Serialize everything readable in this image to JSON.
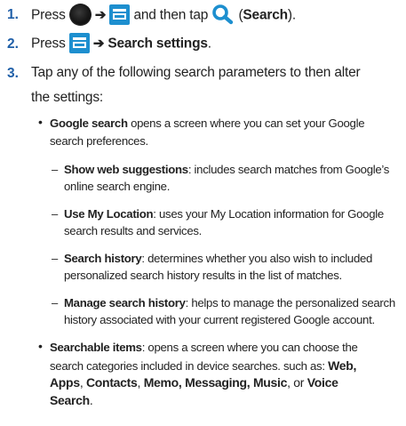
{
  "steps": [
    {
      "number": "1.",
      "text_press": "Press",
      "arrow": "➔",
      "text_and_then": "and then tap",
      "search_label": "Search",
      "icons": [
        "home-key-icon",
        "menu-key-icon",
        "search-icon"
      ]
    },
    {
      "number": "2.",
      "text_press": "Press",
      "arrow": "➔",
      "menu_path": "Search settings",
      "trailing": "."
    },
    {
      "number": "3.",
      "line1": "Tap any of the following search parameters to then alter",
      "line2": "the settings:"
    }
  ],
  "bullets": [
    {
      "term": "Google search",
      "desc_line1": " opens a screen where you can set your Google",
      "desc_line2": "search preferences."
    },
    {
      "term": "Searchable items",
      "desc_line1": ": opens a screen where you can choose the",
      "desc_line2": "search categories included in device searches. such as: ",
      "desc_line2_bold": "Web,",
      "line3_bold1": "Apps",
      "line3_sep1": ", ",
      "line3_bold2": "Contacts",
      "line3_sep2": ", ",
      "line3_bold3": "Memo, Messaging, Music",
      "line3_sep3": ", or ",
      "line3_bold4": "Voice",
      "line4_bold": "Search",
      "line4_tail": "."
    }
  ],
  "subitems": [
    {
      "term": "Show web suggestions",
      "desc_line1": ": includes search matches from Google’s",
      "desc_line2": "online search engine."
    },
    {
      "term": "Use My Location",
      "desc_line1": ": uses your My Location information for Google",
      "desc_line2": "search results and services."
    },
    {
      "term": "Search history",
      "desc_line1": ": determines whether you also wish to included",
      "desc_line2": "personalized search history results in the list of matches."
    },
    {
      "term": "Manage search history",
      "desc_line1": ": helps to manage the personalized search",
      "desc_line2": "history associated with your current registered Google account."
    }
  ],
  "colors": {
    "step_number": "#1f5fa8",
    "menu_key": "#1d8fcf",
    "search_icon": "#1d8fcf",
    "text": "#222222"
  }
}
